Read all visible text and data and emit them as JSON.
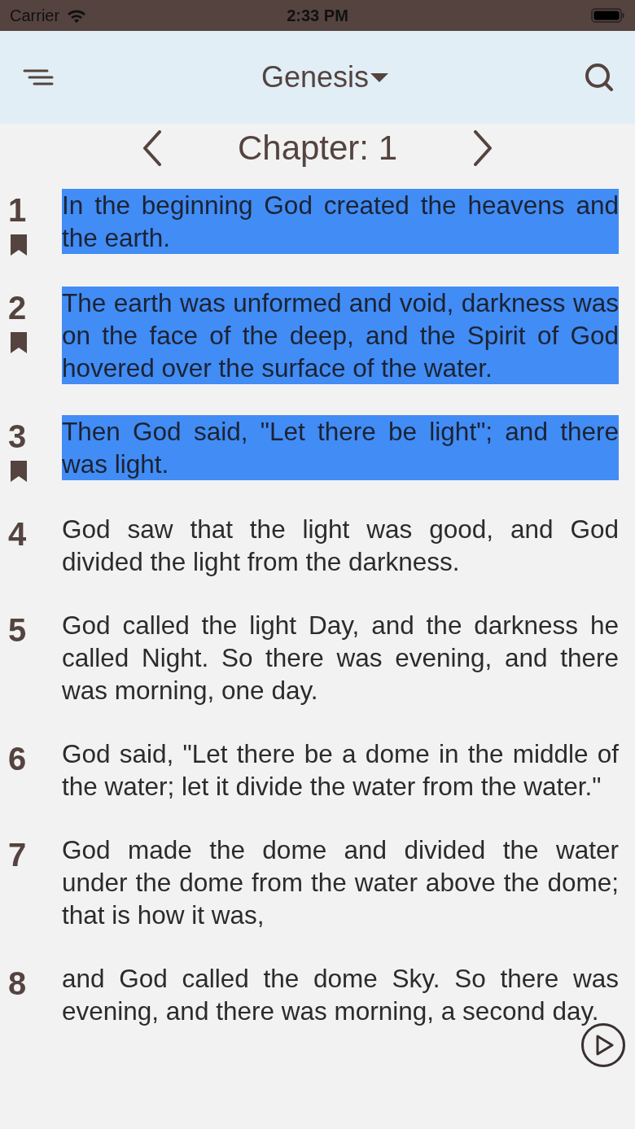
{
  "status_bar": {
    "carrier": "Carrier",
    "time": "2:33 PM"
  },
  "header": {
    "book": "Genesis"
  },
  "chapter_nav": {
    "label": "Chapter: 1"
  },
  "verses": [
    {
      "number": "1",
      "text": "In the beginning God created the heavens and the earth.",
      "highlighted": true,
      "bookmarked": true
    },
    {
      "number": "2",
      "text": "The earth was unformed and void, darkness was on the face of the deep, and the Spirit of God hovered over the surface of the water.",
      "highlighted": true,
      "bookmarked": true
    },
    {
      "number": "3",
      "text": "Then God said, \"Let there be light\"; and there was light.",
      "highlighted": true,
      "bookmarked": true
    },
    {
      "number": "4",
      "text": "God saw that the light was good, and God divided the light from the darkness.",
      "highlighted": false,
      "bookmarked": false
    },
    {
      "number": "5",
      "text": "God called the light Day, and the darkness he called Night. So there was evening, and there was morning, one day.",
      "highlighted": false,
      "bookmarked": false
    },
    {
      "number": "6",
      "text": "God said, \"Let there be a dome in the middle of the water; let it divide the water from the water.\"",
      "highlighted": false,
      "bookmarked": false
    },
    {
      "number": "7",
      "text": "God made the dome and divided the water under the dome from the water above the dome; that is how it was,",
      "highlighted": false,
      "bookmarked": false
    },
    {
      "number": "8",
      "text": "and God called the dome Sky. So there was evening, and there was morning, a second day.",
      "highlighted": false,
      "bookmarked": false
    }
  ]
}
